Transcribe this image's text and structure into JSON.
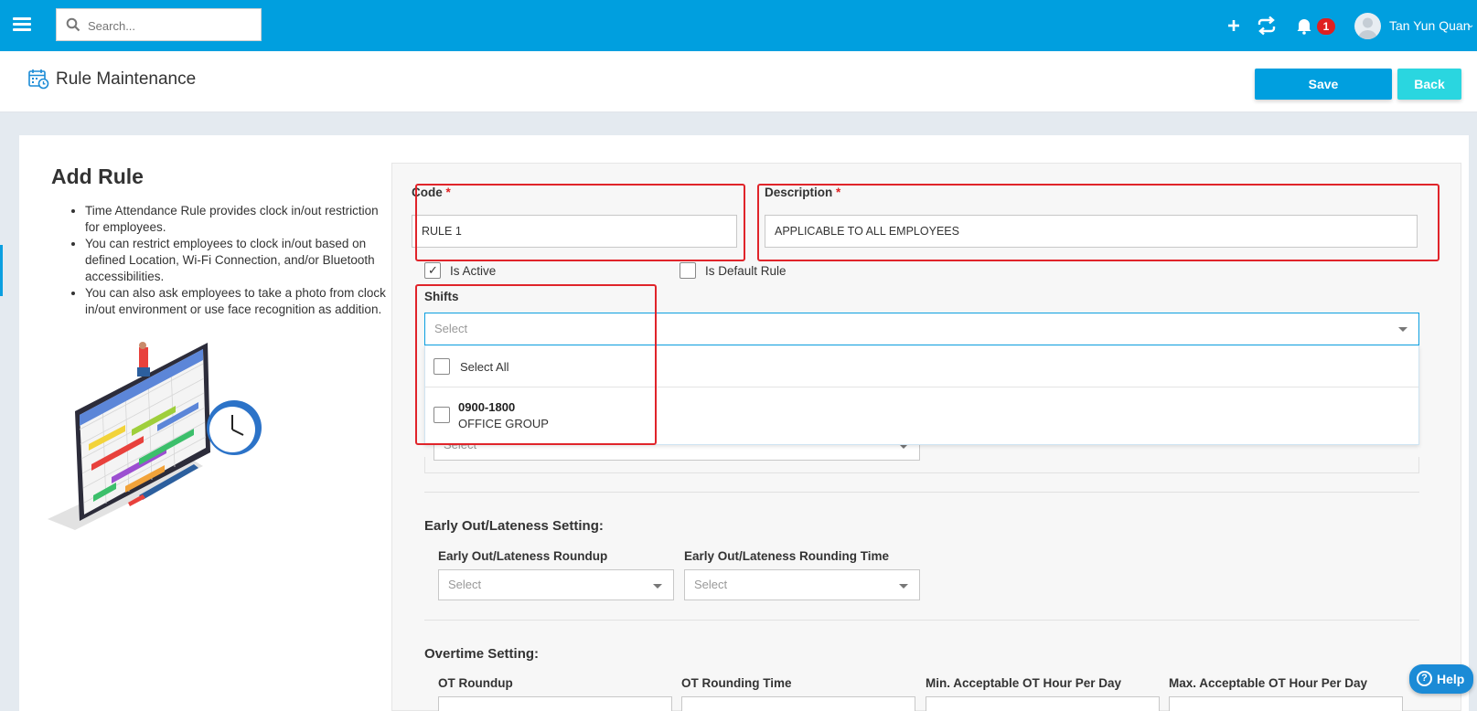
{
  "topbar": {
    "search_placeholder": "Search...",
    "notification_count": "1",
    "user_name": "Tan Yun Quan",
    "icons": [
      "menu-icon",
      "search-icon",
      "plus-icon",
      "sync-icon",
      "bell-icon",
      "user-avatar",
      "chevron-down-icon"
    ]
  },
  "header": {
    "title": "Rule Maintenance",
    "save_label": "Save",
    "back_label": "Back"
  },
  "left": {
    "title": "Add Rule",
    "bullets": [
      "Time Attendance Rule provides clock in/out restriction for employees.",
      "You can restrict employees to clock in/out based on defined Location, Wi-Fi Connection, and/or Bluetooth accessibilities.",
      "You can also ask employees to take a photo from clock in/out environment or use face recognition as addition."
    ]
  },
  "form": {
    "code_label": "Code",
    "code_value": "RULE 1",
    "description_label": "Description",
    "description_value": "APPLICABLE TO ALL EMPLOYEES",
    "required_mark": "*",
    "is_active_label": "Is Active",
    "is_active_checked": true,
    "is_default_label": "Is Default Rule",
    "is_default_checked": false,
    "shifts_label": "Shifts",
    "shifts_placeholder": "Select",
    "shifts_options": [
      {
        "label": "Select All"
      },
      {
        "code": "0900-1800",
        "group": "OFFICE GROUP"
      }
    ],
    "hidden_select_placeholder": "Select",
    "early_out_section": "Early Out/Lateness Setting:",
    "early_out_roundup_label": "Early Out/Lateness Roundup",
    "early_out_roundup_placeholder": "Select",
    "early_out_rounding_time_label": "Early Out/Lateness Rounding Time",
    "early_out_rounding_time_placeholder": "Select",
    "overtime_section": "Overtime Setting:",
    "ot_roundup_label": "OT Roundup",
    "ot_rounding_time_label": "OT Rounding Time",
    "min_ot_label": "Min. Acceptable OT Hour Per Day",
    "max_ot_label": "Max. Acceptable OT Hour Per Day"
  },
  "help_label": "Help",
  "colors": {
    "topbar": "#009fdf",
    "save": "#009fdf",
    "back": "#2ad6e0",
    "highlight": "#e0242a",
    "badge": "#e02020"
  }
}
